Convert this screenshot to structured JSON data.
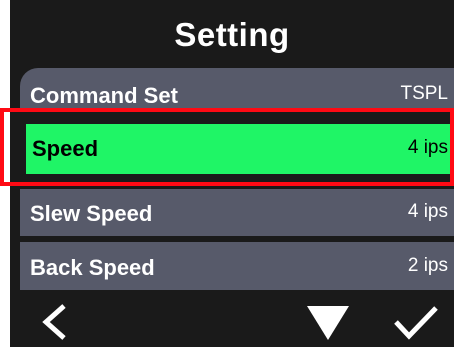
{
  "header": {
    "title": "Setting"
  },
  "menu": {
    "items": [
      {
        "label": "Command Set",
        "value": "TSPL"
      },
      {
        "label": "Speed",
        "value": "4 ips"
      },
      {
        "label": "Slew Speed",
        "value": "4 ips"
      },
      {
        "label": "Back Speed",
        "value": "2 ips"
      }
    ],
    "selected_index": 1
  },
  "softkeys": {
    "back_icon": "chevron-left-icon",
    "down_icon": "triangle-down-icon",
    "confirm_icon": "checkmark-icon"
  },
  "colors": {
    "screen_background": "#1a1a1a",
    "item_background": "#575a6a",
    "selected_background": "#1ff566",
    "highlight_frame": "#ff0a14",
    "text": "#ffffff"
  }
}
